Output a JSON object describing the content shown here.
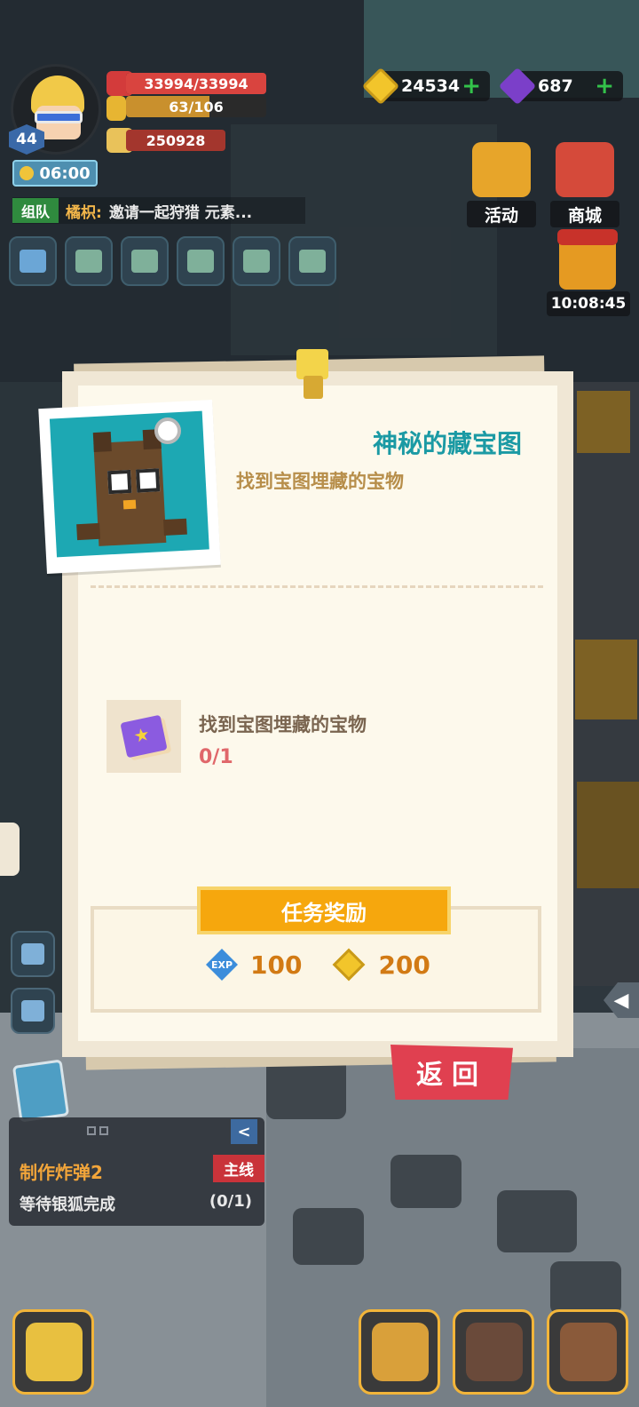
{
  "hud": {
    "level": "44",
    "hp_text": "33994/33994",
    "hp_fraction": 1.0,
    "energy_text": "63/106",
    "energy_fraction": 0.594,
    "power_text": "250928",
    "timer_text": "06:00",
    "team_tag": "组队",
    "team_member": "橘枳:",
    "team_message": "邀请一起狩猎 元素..."
  },
  "currency": {
    "gold": "24534",
    "gems": "687",
    "gold_color": "#f2c52b",
    "gem_color": "#7b3fc9"
  },
  "side_buttons": {
    "activity_label": "活动",
    "shop_label": "商城",
    "gift_timer": "10:08:45"
  },
  "quest": {
    "title": "神秘的藏宝图",
    "subtitle": "找到宝图埋藏的宝物",
    "task_text": "找到宝图埋藏的宝物",
    "task_progress": "0/1",
    "reward_header": "任务奖励",
    "reward_exp_label": "EXP",
    "reward_exp": "100",
    "reward_gold": "200",
    "back_label": "返回",
    "accent_color": "#1b9aa4"
  },
  "tracker": {
    "mission_name": "制作炸弹2",
    "mission_tag": "主线",
    "mission_desc": "等待银狐完成",
    "mission_progress": "(0/1)",
    "collapse_glyph": "<"
  }
}
